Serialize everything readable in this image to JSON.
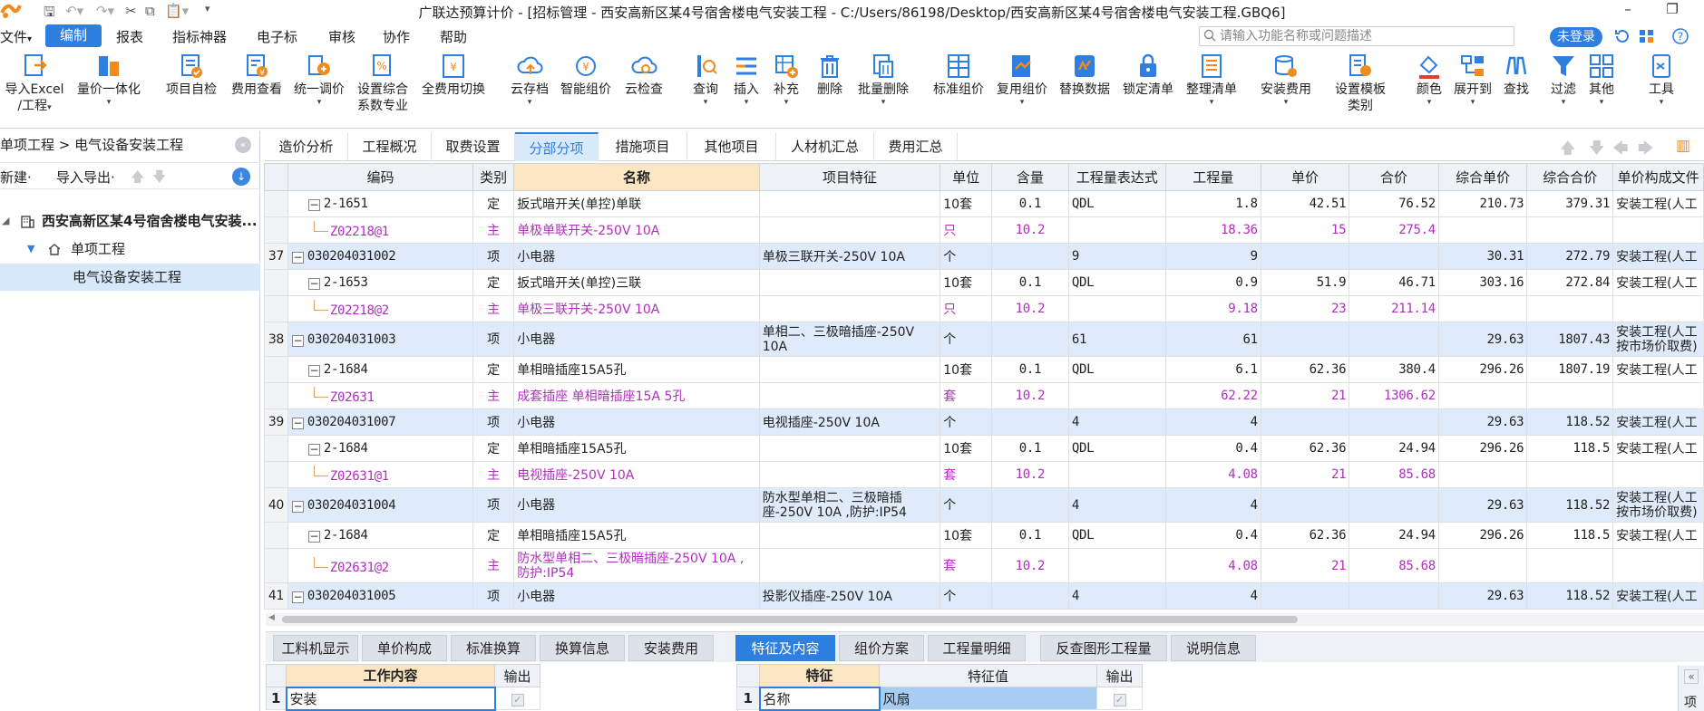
{
  "window": {
    "title": "广联达预算计价 - [招标管理 - 西安高新区某4号宿舍楼电气安装工程 - C:/Users/86198/Desktop/西安高新区某4号宿舍楼电气安装工程.GBQ6]",
    "minimize": "–",
    "restore": "❐"
  },
  "menu": {
    "items": [
      "文件",
      "编制",
      "报表",
      "指标神器",
      "电子标",
      "审核",
      "协作",
      "帮助"
    ],
    "file_caret": "▾",
    "search_placeholder": "请输入功能名称或问题描述",
    "login": "未登录"
  },
  "ribbon": [
    {
      "label": "导入Excel",
      "sub": "/工程",
      "caret": "▾"
    },
    {
      "label": "量价一体化",
      "caret": "▾"
    },
    {
      "label": "项目自检"
    },
    {
      "label": "费用查看"
    },
    {
      "label": "统一调价",
      "caret": "▾"
    },
    {
      "label": "设置综合",
      "sub": "系数专业"
    },
    {
      "label": "全费用切换"
    },
    {
      "label": "云存档",
      "caret": "▾"
    },
    {
      "label": "智能组价"
    },
    {
      "label": "云检查"
    },
    {
      "label": "查询",
      "caret": "▾"
    },
    {
      "label": "插入",
      "caret": "▾"
    },
    {
      "label": "补充",
      "caret": "▾"
    },
    {
      "label": "删除"
    },
    {
      "label": "批量删除",
      "caret": "▾"
    },
    {
      "label": "标准组价"
    },
    {
      "label": "复用组价",
      "caret": "▾"
    },
    {
      "label": "替换数据"
    },
    {
      "label": "锁定清单"
    },
    {
      "label": "整理清单",
      "caret": "▾"
    },
    {
      "label": "安装费用",
      "caret": "▾"
    },
    {
      "label": "设置模板",
      "sub": "类别"
    },
    {
      "label": "颜色",
      "caret": "▾"
    },
    {
      "label": "展开到",
      "caret": "▾"
    },
    {
      "label": "查找"
    },
    {
      "label": "过滤",
      "caret": "▾"
    },
    {
      "label": "其他",
      "caret": "▾"
    },
    {
      "label": "工具",
      "caret": "▾"
    }
  ],
  "nav": {
    "breadcrumb": "单项工程 > 电气设备安装工程",
    "collapse": "«",
    "new": "新建·",
    "import_export": "导入导出·",
    "up": "🡅",
    "down": "🡇",
    "download": "↓",
    "project": "西安高新区某4号宿舍楼电气安装...",
    "single": "单项工程",
    "unit": "电气设备安装工程"
  },
  "tabs": [
    "造价分析",
    "工程概况",
    "取费设置",
    "分部分项",
    "措施项目",
    "其他项目",
    "人材机汇总",
    "费用汇总"
  ],
  "grid": {
    "headers": [
      "编码",
      "类别",
      "名称",
      "项目特征",
      "单位",
      "含量",
      "工程量表达式",
      "工程量",
      "单价",
      "合价",
      "综合单价",
      "综合合价",
      "单价构成文件"
    ],
    "rows": [
      {
        "type": "ding",
        "no": "",
        "code": "2-1651",
        "cat": "定",
        "name": "扳式暗开关(单控)单联",
        "feature": "",
        "unit": "10套",
        "qty_ratio": "0.1",
        "expr": "QDL",
        "qty": "1.8",
        "price": "42.51",
        "total": "76.52",
        "comp_price": "210.73",
        "comp_total": "379.31",
        "file": "安装工程(人工"
      },
      {
        "type": "zhu",
        "no": "",
        "code": "Z02218@1",
        "cat": "主",
        "name": "单极单联开关-250V  10A",
        "feature": "",
        "unit": "只",
        "qty_ratio": "10.2",
        "expr": "",
        "qty": "18.36",
        "price": "15",
        "total": "275.4",
        "comp_price": "",
        "comp_total": "",
        "file": ""
      },
      {
        "type": "xiang",
        "no": "37",
        "code": "030204031002",
        "cat": "项",
        "name": "小电器",
        "feature": "单极三联开关-250V  10A",
        "unit": "个",
        "qty_ratio": "",
        "expr": "9",
        "qty": "9",
        "price": "",
        "total": "",
        "comp_price": "30.31",
        "comp_total": "272.79",
        "file": "安装工程(人工"
      },
      {
        "type": "ding",
        "no": "",
        "code": "2-1653",
        "cat": "定",
        "name": "扳式暗开关(单控)三联",
        "feature": "",
        "unit": "10套",
        "qty_ratio": "0.1",
        "expr": "QDL",
        "qty": "0.9",
        "price": "51.9",
        "total": "46.71",
        "comp_price": "303.16",
        "comp_total": "272.84",
        "file": "安装工程(人工"
      },
      {
        "type": "zhu",
        "no": "",
        "code": "Z02218@2",
        "cat": "主",
        "name": "单极三联开关-250V  10A",
        "feature": "",
        "unit": "只",
        "qty_ratio": "10.2",
        "expr": "",
        "qty": "9.18",
        "price": "23",
        "total": "211.14",
        "comp_price": "",
        "comp_total": "",
        "file": ""
      },
      {
        "type": "xiang",
        "tall": true,
        "no": "38",
        "code": "030204031003",
        "cat": "项",
        "name": "小电器",
        "feature": "单相二、三极暗插座-250V 10A",
        "unit": "个",
        "qty_ratio": "",
        "expr": "61",
        "qty": "61",
        "price": "",
        "total": "",
        "comp_price": "29.63",
        "comp_total": "1807.43",
        "file": "安装工程(人工按市场价取费)"
      },
      {
        "type": "ding",
        "no": "",
        "code": "2-1684",
        "cat": "定",
        "name": "单相暗插座15A5孔",
        "feature": "",
        "unit": "10套",
        "qty_ratio": "0.1",
        "expr": "QDL",
        "qty": "6.1",
        "price": "62.36",
        "total": "380.4",
        "comp_price": "296.26",
        "comp_total": "1807.19",
        "file": "安装工程(人工"
      },
      {
        "type": "zhu",
        "no": "",
        "code": "Z02631",
        "cat": "主",
        "name": "成套插座 单相暗插座15A 5孔",
        "feature": "",
        "unit": "套",
        "qty_ratio": "10.2",
        "expr": "",
        "qty": "62.22",
        "price": "21",
        "total": "1306.62",
        "comp_price": "",
        "comp_total": "",
        "file": ""
      },
      {
        "type": "xiang",
        "no": "39",
        "code": "030204031007",
        "cat": "项",
        "name": "小电器",
        "feature": "电视插座-250V  10A",
        "unit": "个",
        "qty_ratio": "",
        "expr": "4",
        "qty": "4",
        "price": "",
        "total": "",
        "comp_price": "29.63",
        "comp_total": "118.52",
        "file": "安装工程(人工"
      },
      {
        "type": "ding",
        "no": "",
        "code": "2-1684",
        "cat": "定",
        "name": "单相暗插座15A5孔",
        "feature": "",
        "unit": "10套",
        "qty_ratio": "0.1",
        "expr": "QDL",
        "qty": "0.4",
        "price": "62.36",
        "total": "24.94",
        "comp_price": "296.26",
        "comp_total": "118.5",
        "file": "安装工程(人工"
      },
      {
        "type": "zhu",
        "no": "",
        "code": "Z02631@1",
        "cat": "主",
        "name": "电视插座-250V  10A",
        "feature": "",
        "unit": "套",
        "qty_ratio": "10.2",
        "expr": "",
        "qty": "4.08",
        "price": "21",
        "total": "85.68",
        "comp_price": "",
        "comp_total": "",
        "file": ""
      },
      {
        "type": "xiang",
        "tall": true,
        "no": "40",
        "code": "030204031004",
        "cat": "项",
        "name": "小电器",
        "feature": "防水型单相二、三极暗插座-250V  10A ,防护:IP54",
        "unit": "个",
        "qty_ratio": "",
        "expr": "4",
        "qty": "4",
        "price": "",
        "total": "",
        "comp_price": "29.63",
        "comp_total": "118.52",
        "file": "安装工程(人工按市场价取费)"
      },
      {
        "type": "ding",
        "no": "",
        "code": "2-1684",
        "cat": "定",
        "name": "单相暗插座15A5孔",
        "feature": "",
        "unit": "10套",
        "qty_ratio": "0.1",
        "expr": "QDL",
        "qty": "0.4",
        "price": "62.36",
        "total": "24.94",
        "comp_price": "296.26",
        "comp_total": "118.5",
        "file": "安装工程(人工"
      },
      {
        "type": "zhu",
        "tall": true,
        "no": "",
        "code": "Z02631@2",
        "cat": "主",
        "name": "防水型单相二、三极暗插座-250V  10A ,防护:IP54",
        "feature": "",
        "unit": "套",
        "qty_ratio": "10.2",
        "expr": "",
        "qty": "4.08",
        "price": "21",
        "total": "85.68",
        "comp_price": "",
        "comp_total": "",
        "file": ""
      },
      {
        "type": "xiang",
        "no": "41",
        "code": "030204031005",
        "cat": "项",
        "name": "小电器",
        "feature": "投影仪插座-250V  10A",
        "unit": "个",
        "qty_ratio": "",
        "expr": "4",
        "qty": "4",
        "price": "",
        "total": "",
        "comp_price": "29.63",
        "comp_total": "118.52",
        "file": "安装工程(人工"
      }
    ]
  },
  "bottom_tabs": [
    "工料机显示",
    "单价构成",
    "标准换算",
    "换算信息",
    "安装费用",
    "特征及内容",
    "组价方案",
    "工程量明细",
    "反查图形工程量",
    "说明信息"
  ],
  "work_table": {
    "headers": [
      "工作内容",
      "输出"
    ],
    "rows": [
      {
        "no": "1",
        "content": "安装"
      }
    ]
  },
  "feature_table": {
    "headers": [
      "特征",
      "特征值",
      "输出"
    ],
    "rows": [
      {
        "no": "1",
        "feature": "名称",
        "value": "风扇"
      }
    ]
  },
  "side_panel": {
    "collapse": "«",
    "label": "项"
  },
  "checkmark": "✓",
  "colors": {
    "accent": "#2e7fe0",
    "main_material": "#b02fbe",
    "item_row": "#dfeafa"
  }
}
